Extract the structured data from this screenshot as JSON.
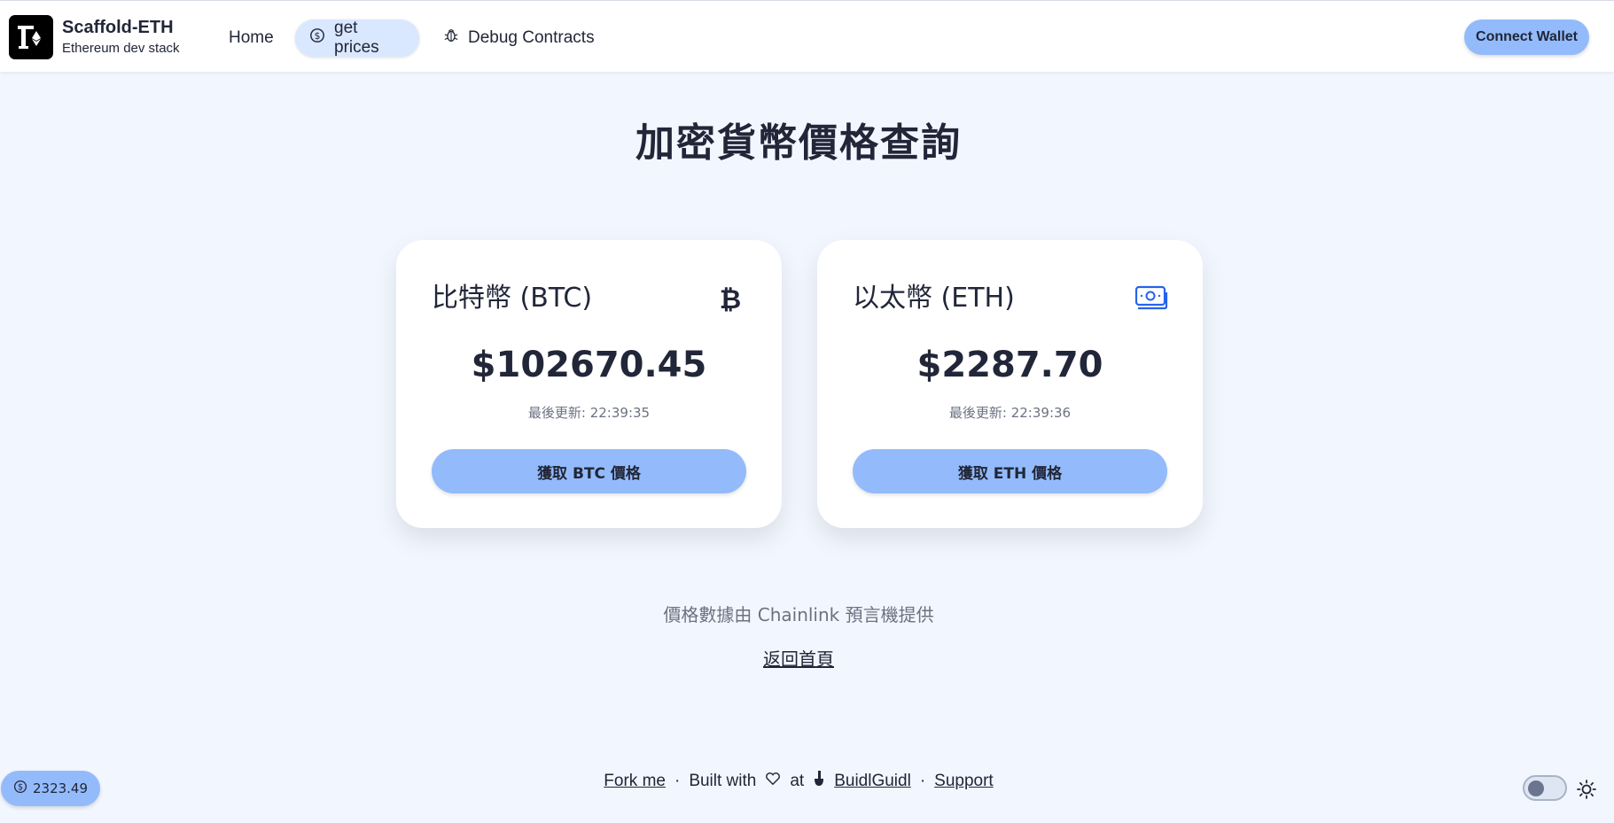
{
  "header": {
    "brand_title": "Scaffold-ETH",
    "brand_subtitle": "Ethereum dev stack",
    "nav": {
      "home": "Home",
      "get_prices": "get prices",
      "debug_contracts": "Debug Contracts"
    },
    "connect_wallet": "Connect Wallet"
  },
  "main": {
    "title": "加密貨幣價格查詢",
    "cards": [
      {
        "title": "比特幣 (BTC)",
        "icon": "bitcoin-icon",
        "price": "$102670.45",
        "updated": "最後更新: 22:39:35",
        "button": "獲取 BTC 價格"
      },
      {
        "title": "以太幣 (ETH)",
        "icon": "banknotes-icon",
        "price": "$2287.70",
        "updated": "最後更新: 22:39:36",
        "button": "獲取 ETH 價格"
      }
    ],
    "source_text": "價格數據由 Chainlink 預言機提供",
    "back_link": "返回首頁"
  },
  "footer": {
    "balance": "2323.49",
    "fork_me": "Fork me",
    "separator": "·",
    "built_with": "Built with",
    "at": "at",
    "buidlguidl": "BuidlGuidl",
    "support": "Support"
  },
  "colors": {
    "background": "#f2f7ff",
    "primary": "#93bbfb",
    "nav_active": "#dae8ff",
    "text": "#212638",
    "accent_blue": "#2563eb"
  }
}
